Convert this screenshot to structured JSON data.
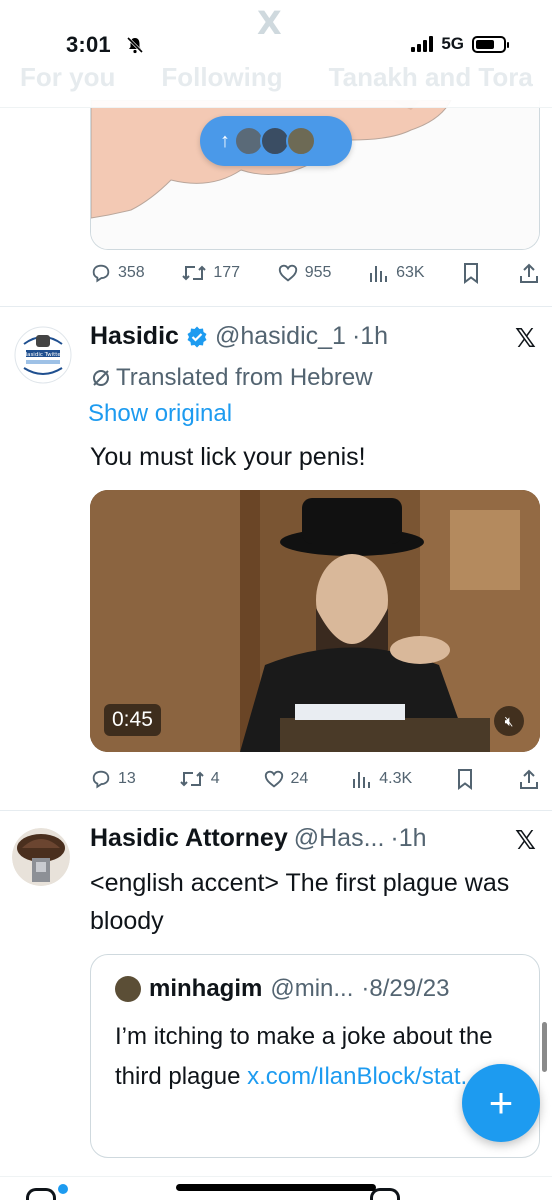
{
  "status": {
    "time": "3:01",
    "network": "5G"
  },
  "header": {
    "tabs": [
      "For you",
      "Following",
      "Tanakh and Tora"
    ]
  },
  "new_posts_pill": {
    "arrow": "↑"
  },
  "tweet1": {
    "replies": "358",
    "retweets": "177",
    "likes": "955",
    "views": "63K"
  },
  "tweet2": {
    "name": "Hasidic",
    "handle": "@hasidic_1",
    "time": "·1h",
    "avatar_text": "Hasidic Twitter",
    "translated": "Translated from Hebrew",
    "show_original": "Show original",
    "text": "You must lick your penis!",
    "video_duration": "0:45",
    "replies": "13",
    "retweets": "4",
    "likes": "24",
    "views": "4.3K"
  },
  "tweet3": {
    "name": "Hasidic Attorney",
    "handle": "@Has...",
    "time": "·1h",
    "text": "<english accent> The first plague was bloody",
    "quote": {
      "name": "minhagim",
      "handle": "@min...",
      "date": "·8/29/23",
      "text": "I’m itching to make a joke about the third plague ",
      "link": "x.com/IlanBlock/stat..."
    }
  },
  "fab_label": "+",
  "x_mark": "𝕏",
  "colors": {
    "accent": "#1d9bf0",
    "text": "#0f1419",
    "muted": "#536471"
  }
}
